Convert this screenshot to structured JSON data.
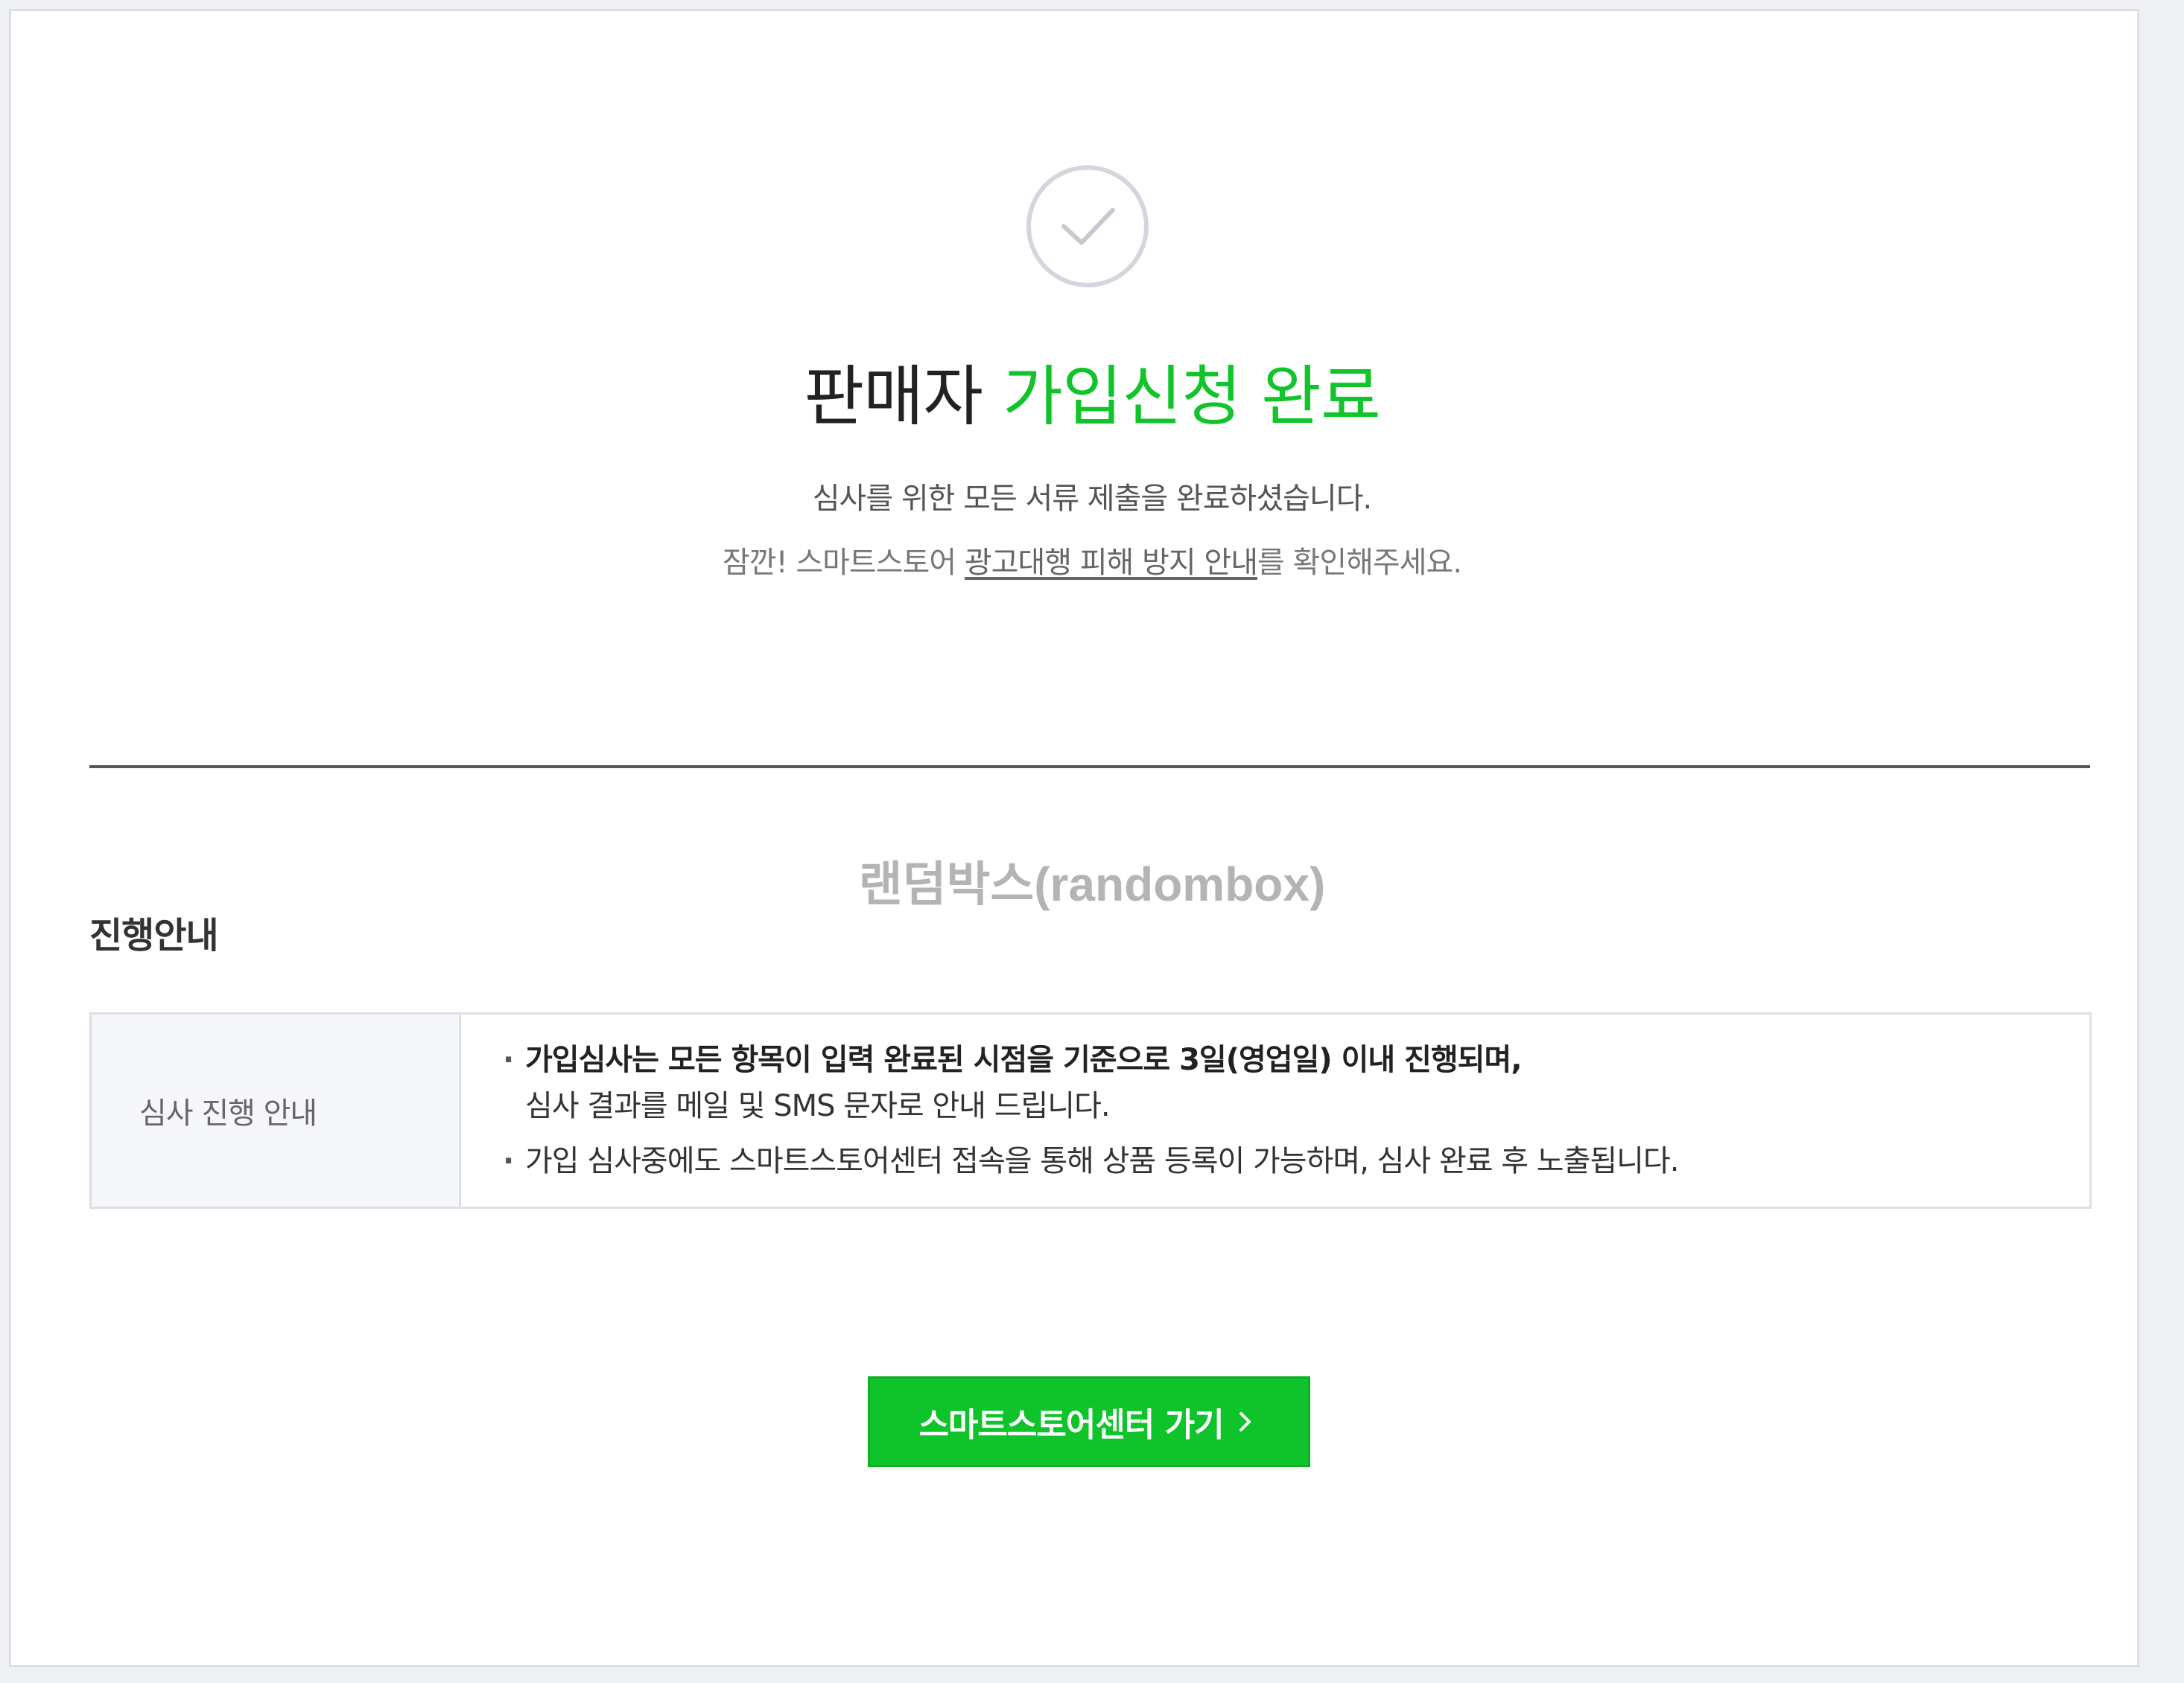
{
  "completion": {
    "title_prefix": "판매자 ",
    "title_accent": "가입신청 완료",
    "description": "심사를 위한 모든 서류 제출을 완료하셨습니다.",
    "notice_prefix": "잠깐! 스마트스토어 ",
    "notice_link": "광고대행 피해 방지 안내",
    "notice_suffix": "를 확인해주세요."
  },
  "watermark": "랜덤박스(randombox)",
  "progress": {
    "section_title": "진행안내",
    "row_header": "심사 진행 안내",
    "items": [
      {
        "bold": "가입심사는 모든 항목이 입력 완료된 시점을 기준으로 3일(영업일) 이내 진행되며,",
        "rest": "심사 결과를 메일 및 SMS 문자로 안내 드립니다."
      },
      {
        "text": "가입 심사중에도 스마트스토어센터 접속을 통해 상품 등록이 가능하며, 심사 완료 후 노출됩니다."
      }
    ]
  },
  "cta": {
    "label": "스마트스토어센터 가기"
  },
  "colors": {
    "accent": "#12c42b",
    "button": "#0fc42a",
    "icon_gray": "#d3d6dc"
  },
  "icons": {
    "status": "check-circle-icon",
    "button_arrow": "chevron-right-icon"
  }
}
